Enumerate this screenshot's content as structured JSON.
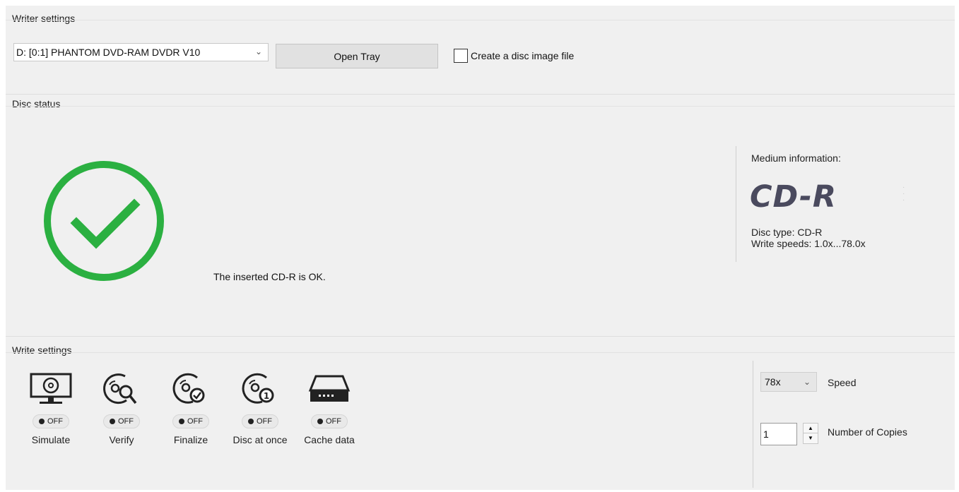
{
  "writer_settings": {
    "title": "Writer settings",
    "drive": "D: [0:1] PHANTOM DVD-RAM DVDR V10",
    "open_tray_label": "Open Tray",
    "create_image_label": "Create a disc image file"
  },
  "disc_status": {
    "title": "Disc status",
    "message": "The inserted CD-R is OK.",
    "status_color": "#2bb041",
    "medium_title": "Medium information:",
    "medium_type_big": "CD-R",
    "disc_type": "Disc type: CD-R",
    "write_speeds": "Write speeds: 1.0x...78.0x"
  },
  "write_settings": {
    "title": "Write settings",
    "options": [
      {
        "label": "Simulate",
        "state": "OFF",
        "icon": "monitor-disc-icon"
      },
      {
        "label": "Verify",
        "state": "OFF",
        "icon": "disc-magnifier-icon"
      },
      {
        "label": "Finalize",
        "state": "OFF",
        "icon": "disc-check-icon"
      },
      {
        "label": "Disc at once",
        "state": "OFF",
        "icon": "disc-one-icon"
      },
      {
        "label": "Cache data",
        "state": "OFF",
        "icon": "drive-icon"
      }
    ],
    "speed_value": "78x",
    "speed_label": "Speed",
    "copies_value": "1",
    "copies_label": "Number of Copies"
  }
}
